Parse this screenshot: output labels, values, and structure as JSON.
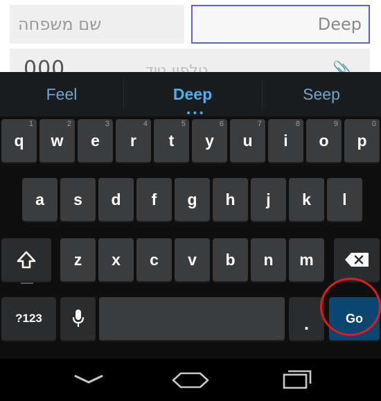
{
  "form": {
    "last_name_placeholder": "שם משפחה",
    "first_name_value": "Deep",
    "phone_value": "000",
    "phone_hint": "טלפון נייד"
  },
  "keyboard": {
    "suggestions": [
      "Feel",
      "Deep",
      "Seep"
    ],
    "row1": [
      {
        "label": "q",
        "hint": "1"
      },
      {
        "label": "w",
        "hint": "2"
      },
      {
        "label": "e",
        "hint": "3"
      },
      {
        "label": "r",
        "hint": "4"
      },
      {
        "label": "t",
        "hint": "5"
      },
      {
        "label": "y",
        "hint": "6"
      },
      {
        "label": "u",
        "hint": "7"
      },
      {
        "label": "i",
        "hint": "8"
      },
      {
        "label": "o",
        "hint": "9"
      },
      {
        "label": "p",
        "hint": "0"
      }
    ],
    "row2": [
      "a",
      "s",
      "d",
      "f",
      "g",
      "h",
      "j",
      "k",
      "l"
    ],
    "row3": [
      "z",
      "x",
      "c",
      "v",
      "b",
      "n",
      "m"
    ],
    "symbols_label": "?123",
    "period_label": ".",
    "go_label": "Go"
  },
  "colors": {
    "focus_border": "#5c62d6",
    "suggestion": "#4db0e8",
    "go_key": "#0b4670",
    "annotation_circle": "#e01b1b"
  },
  "icons": {
    "shift": "shift-icon",
    "backspace": "backspace-icon",
    "mic": "microphone-icon",
    "back": "back-icon",
    "home": "home-icon",
    "recents": "recent-apps-icon"
  }
}
